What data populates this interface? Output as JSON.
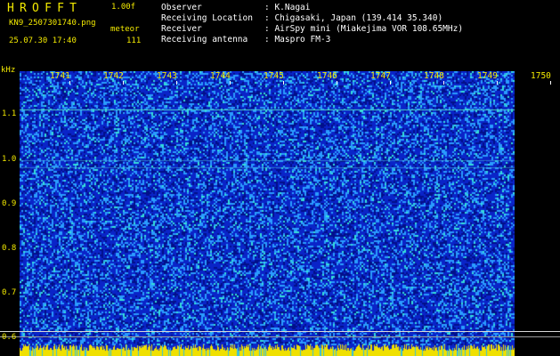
{
  "header": {
    "app_title": "HROFFT",
    "version": "1.00f",
    "filename": "KN9_2507301740.png",
    "mode": "meteor",
    "timestamp": "25.07.30 17:40",
    "count": "111"
  },
  "station_info": [
    {
      "label": "Observer",
      "value": ": K.Nagai"
    },
    {
      "label": "Receiving Location",
      "value": ": Chigasaki, Japan (139.414 35.340)"
    },
    {
      "label": "Receiver",
      "value": ": AirSpy mini (Miakejima VOR 108.65MHz)"
    },
    {
      "label": "Receiving antenna",
      "value": ": Maspro FM-3"
    }
  ],
  "plot": {
    "y_unit": "kHz",
    "y_ticks": [
      "1.1",
      "1.0",
      "0.9",
      "0.8",
      "0.7",
      "0.6"
    ],
    "x_ticks": [
      "1741",
      "1742",
      "1743",
      "1744",
      "1745",
      "1746",
      "1747",
      "1748",
      "1749",
      "1750"
    ],
    "colors": {
      "background": "#0a24c8",
      "noise_light": "#2a9cff",
      "noise_cyan": "#35e0d8",
      "noise_dark": "#02108a",
      "axis_text": "#f3ea00",
      "bottom_strip": "#f0e000"
    }
  }
}
